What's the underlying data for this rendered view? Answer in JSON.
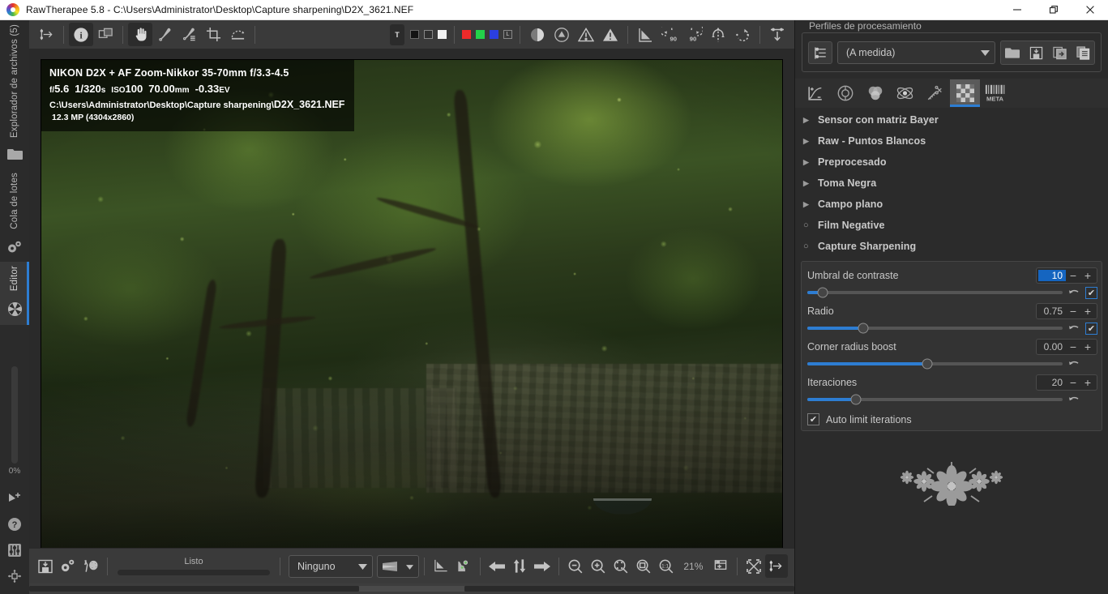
{
  "window": {
    "title": "RawTherapee 5.8 - C:\\Users\\Administrator\\Desktop\\Capture sharpening\\D2X_3621.NEF",
    "minimize_label": "Minimize",
    "restore_label": "Restore",
    "close_label": "Close"
  },
  "left_rail": {
    "tabs": [
      {
        "label": "Explorador de archivos (5)",
        "icon": "folder-icon",
        "active": false
      },
      {
        "label": "Cola de lotes",
        "icon": "gears-icon",
        "active": false
      },
      {
        "label": "Editor",
        "icon": "aperture-icon",
        "active": true
      }
    ],
    "progress_label": "0%",
    "bottom_icons": [
      {
        "name": "navigator-icon"
      },
      {
        "name": "help-icon"
      },
      {
        "name": "preferences-icon"
      },
      {
        "name": "move-icon"
      }
    ]
  },
  "toolbar": {
    "left_tools": [
      {
        "name": "toggle-left-panel-icon",
        "label": "Toggle left panel",
        "active": false
      },
      {
        "name": "info-icon",
        "label": "Show info",
        "active": true
      },
      {
        "name": "before-after-icon",
        "label": "Before/after view",
        "active": false
      },
      {
        "name": "hand-icon",
        "label": "Hand tool",
        "active": true
      },
      {
        "name": "white-balance-picker-icon",
        "label": "White balance picker",
        "active": false
      },
      {
        "name": "lockable-color-picker-icon",
        "label": "Lockable color picker",
        "active": false
      },
      {
        "name": "crop-icon",
        "label": "Crop",
        "active": false
      },
      {
        "name": "straighten-icon",
        "label": "Straighten",
        "active": false
      }
    ],
    "indicator_badge": "T",
    "clip_swatches": [
      {
        "name": "swatch-black-filled",
        "color": "#141414"
      },
      {
        "name": "swatch-black-outline",
        "color": "#2f2f2f"
      },
      {
        "name": "swatch-white",
        "color": "#f2f2f2"
      }
    ],
    "channel_swatches": [
      {
        "name": "swatch-red",
        "color": "#ef2a2a"
      },
      {
        "name": "swatch-green",
        "color": "#23d24a"
      },
      {
        "name": "swatch-blue",
        "color": "#2b3fe0"
      },
      {
        "name": "swatch-luminance",
        "color": "#3a3a3a",
        "glyph": "L"
      }
    ],
    "right_tools": [
      {
        "name": "shadow-clipping-icon",
        "label": "Shadow clipping"
      },
      {
        "name": "highlight-clipping-icon",
        "label": "Highlight clipping"
      },
      {
        "name": "gamut-warning-icon",
        "label": "Gamut warning"
      },
      {
        "name": "focus-mask-icon",
        "label": "Focus mask"
      },
      {
        "name": "perspective-icon",
        "label": "Perspective"
      },
      {
        "name": "rotate-left-90-icon",
        "label": "90"
      },
      {
        "name": "rotate-right-90-icon",
        "label": "90"
      },
      {
        "name": "flip-vertical-icon",
        "label": "Flip vertical"
      },
      {
        "name": "flip-horizontal-icon",
        "label": "Flip horizontal"
      },
      {
        "name": "toggle-right-panel-icon",
        "label": "Toggle right panel"
      }
    ]
  },
  "photo_overlay": {
    "camera_line": "NIKON D2X + AF Zoom-Nikkor 35-70mm f/3.3-4.5",
    "aperture_prefix": "f/",
    "aperture": "5.6",
    "shutter": "1/320",
    "shutter_unit": "s",
    "iso_prefix": "ISO",
    "iso": "100",
    "focal": "70.00",
    "focal_unit": "mm",
    "exposure_comp": "-0.33",
    "exposure_unit": "EV",
    "path": "C:\\Users\\Administrator\\Desktop\\Capture sharpening\\",
    "filename": "D2X_3621.NEF",
    "dimensions": "12.3 MP (4304x2860)"
  },
  "bottom_bar": {
    "left_icons": [
      {
        "name": "save-image-icon",
        "label": "Save current image"
      },
      {
        "name": "queue-icon",
        "label": "Put to queue"
      },
      {
        "name": "send-to-editor-icon",
        "label": "Edit current image in external editor"
      }
    ],
    "status_text": "Listo",
    "soft_proof_combo": "Ninguno",
    "gamut_combo_name": "gamut-check-combo",
    "nav_icons": [
      {
        "name": "before-view-icon"
      },
      {
        "name": "after-view-icon"
      },
      {
        "name": "previous-image-icon"
      },
      {
        "name": "sync-thumbnail-icon"
      },
      {
        "name": "next-image-icon"
      }
    ],
    "zoom_icons": [
      {
        "name": "zoom-out-icon"
      },
      {
        "name": "zoom-in-icon"
      },
      {
        "name": "zoom-fit-crop-icon"
      },
      {
        "name": "zoom-fit-icon"
      },
      {
        "name": "zoom-100-icon"
      }
    ],
    "zoom_level": "21%",
    "right_icons": [
      {
        "name": "add-window-icon"
      },
      {
        "name": "fullscreen-icon"
      },
      {
        "name": "toggle-right-panel-icon"
      }
    ]
  },
  "right_panel": {
    "processing_profiles_legend": "Perfiles de procesamiento",
    "profile_list_icon": "profile-list-icon",
    "profile_value": "(A medida)",
    "profile_buttons": [
      {
        "name": "load-profile-icon",
        "label": "Load profile"
      },
      {
        "name": "save-profile-icon",
        "label": "Save profile"
      },
      {
        "name": "paste-profile-icon",
        "label": "Paste profile"
      },
      {
        "name": "copy-profile-icon",
        "label": "Copy profile"
      }
    ],
    "tabs": [
      {
        "name": "tab-exposure",
        "label": "Exposure",
        "active": false
      },
      {
        "name": "tab-detail",
        "label": "Detail",
        "active": false
      },
      {
        "name": "tab-color",
        "label": "Color",
        "active": false
      },
      {
        "name": "tab-advanced",
        "label": "Advanced",
        "active": false
      },
      {
        "name": "tab-transform",
        "label": "Transform",
        "active": false
      },
      {
        "name": "tab-raw",
        "label": "Raw",
        "active": true
      },
      {
        "name": "tab-metadata",
        "label": "META",
        "active": false
      }
    ],
    "sections": [
      {
        "label": "Sensor con matriz Bayer",
        "marker": "triangle"
      },
      {
        "label": "Raw - Puntos Blancos",
        "marker": "triangle"
      },
      {
        "label": "Preprocesado",
        "marker": "triangle"
      },
      {
        "label": "Toma Negra",
        "marker": "triangle"
      },
      {
        "label": "Campo plano",
        "marker": "triangle"
      },
      {
        "label": "Film Negative",
        "marker": "circle"
      },
      {
        "label": "Capture Sharpening",
        "marker": "circle"
      }
    ],
    "sliders": [
      {
        "label": "Umbral de contraste",
        "value": "10",
        "value_selected": true,
        "fill_percent": 6,
        "knob_percent": 6,
        "minus": "−",
        "plus": "+",
        "has_checkbox": true,
        "checkbox_checked": true
      },
      {
        "label": "Radio",
        "value": "0.75",
        "value_selected": false,
        "fill_percent": 22,
        "knob_percent": 22,
        "minus": "−",
        "plus": "+",
        "has_checkbox": true,
        "checkbox_checked": true
      },
      {
        "label": "Corner radius boost",
        "value": "0.00",
        "value_selected": false,
        "fill_percent": 47,
        "knob_percent": 47,
        "minus": "−",
        "plus": "+",
        "has_checkbox": false,
        "checkbox_checked": false
      },
      {
        "label": "Iteraciones",
        "value": "20",
        "value_selected": false,
        "fill_percent": 19,
        "knob_percent": 19,
        "minus": "−",
        "plus": "+",
        "has_checkbox": false,
        "checkbox_checked": false
      }
    ],
    "auto_limit": {
      "label": "Auto limit iterations",
      "checked": true,
      "check_glyph": "✔"
    },
    "ornament_name": "flower-ornament"
  },
  "colors": {
    "accent_blue": "#2d7dd2",
    "selection_blue": "#1565c0",
    "panel_bg": "#2b2b2b",
    "toolbar_bg": "#3a3a3a",
    "canvas_bg": "#2a2a2a",
    "section_text": "#c9c9c9"
  }
}
